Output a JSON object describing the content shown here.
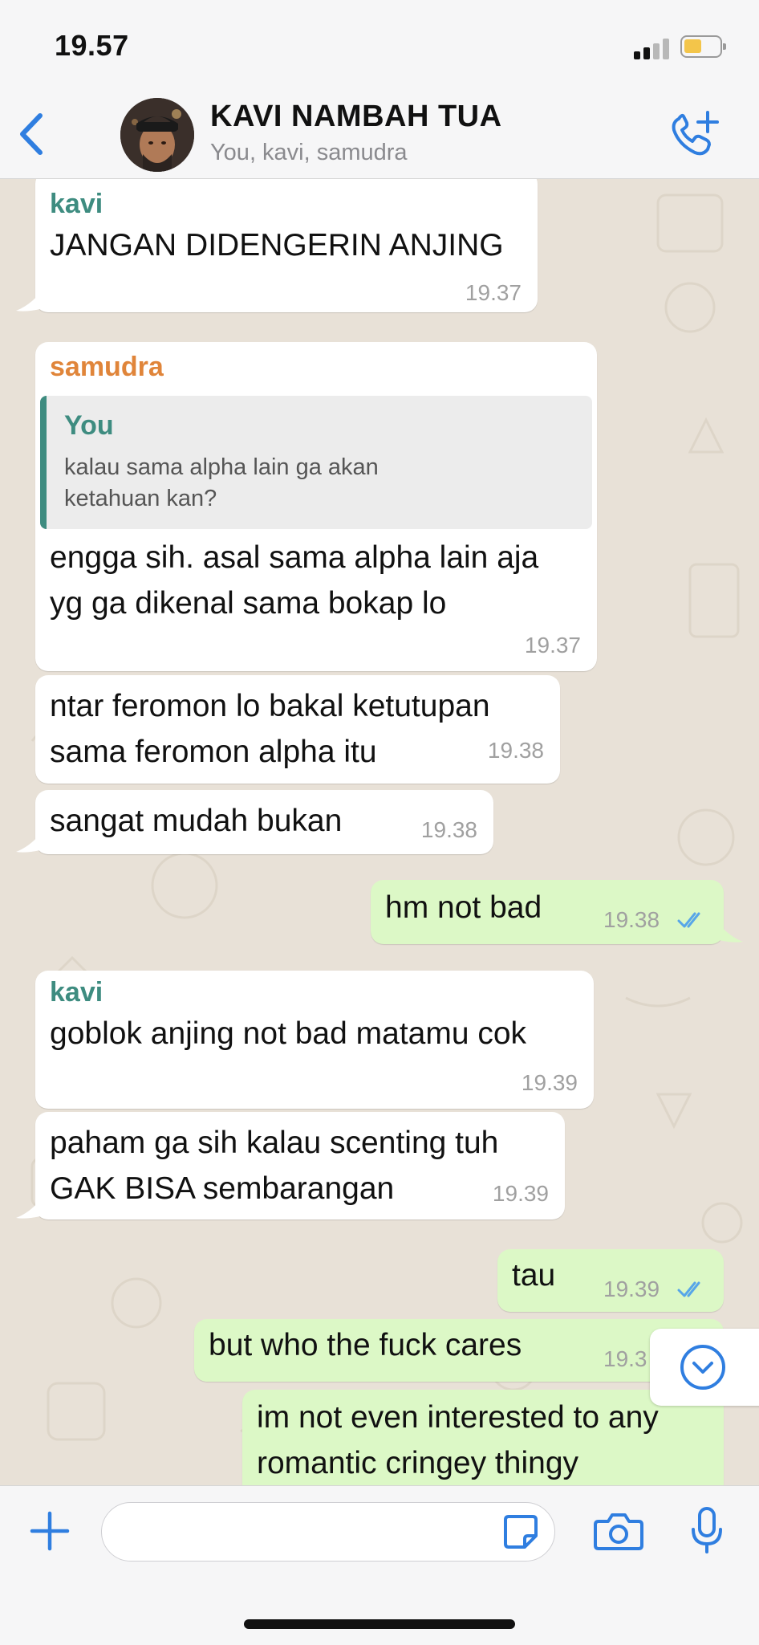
{
  "status_bar": {
    "time": "19.57"
  },
  "header": {
    "back_icon": "chevron-left-icon",
    "title": "KAVI NAMBAH TUA",
    "subtitle": "You, kavi, samudra",
    "call_icon": "phone-plus-icon"
  },
  "colors": {
    "accent": "#2f7ee0",
    "kavi": "#3e8c80",
    "samudra": "#e0853a",
    "outgoing": "#dcf8c6",
    "incoming": "#ffffff",
    "read_ticks": "#57a6e8"
  },
  "messages": [
    {
      "sender": "kavi",
      "text": "JANGAN DIDENGERIN ANJING",
      "time": "19.37"
    },
    {
      "sender": "samudra",
      "quote_name": "You",
      "quote_text": "kalau sama alpha lain ga akan\nketahuan kan?",
      "text": "engga sih. asal sama alpha lain aja\nyg ga dikenal sama bokap lo",
      "time": "19.37"
    },
    {
      "text": "ntar feromon lo bakal ketutupan\nsama feromon alpha itu",
      "time": "19.38"
    },
    {
      "text": "sangat mudah bukan",
      "time": "19.38"
    },
    {
      "outgoing": true,
      "text": "hm not bad",
      "time": "19.38"
    },
    {
      "sender": "kavi",
      "text": "goblok anjing not bad matamu cok",
      "time": "19.39"
    },
    {
      "text": "paham ga sih kalau scenting tuh\nGAK BISA sembarangan",
      "time": "19.39"
    },
    {
      "outgoing": true,
      "text": "tau",
      "time": "19.39"
    },
    {
      "outgoing": true,
      "text": "but who the fuck cares",
      "time": "19.3"
    },
    {
      "outgoing": true,
      "text": "im not even interested to any\nromantic cringey thingy"
    }
  ],
  "scroll_icon": "chevron-down-circle-icon",
  "input_bar": {
    "plus_icon": "plus-icon",
    "sticker_icon": "sticker-icon",
    "camera_icon": "camera-icon",
    "mic_icon": "microphone-icon"
  }
}
